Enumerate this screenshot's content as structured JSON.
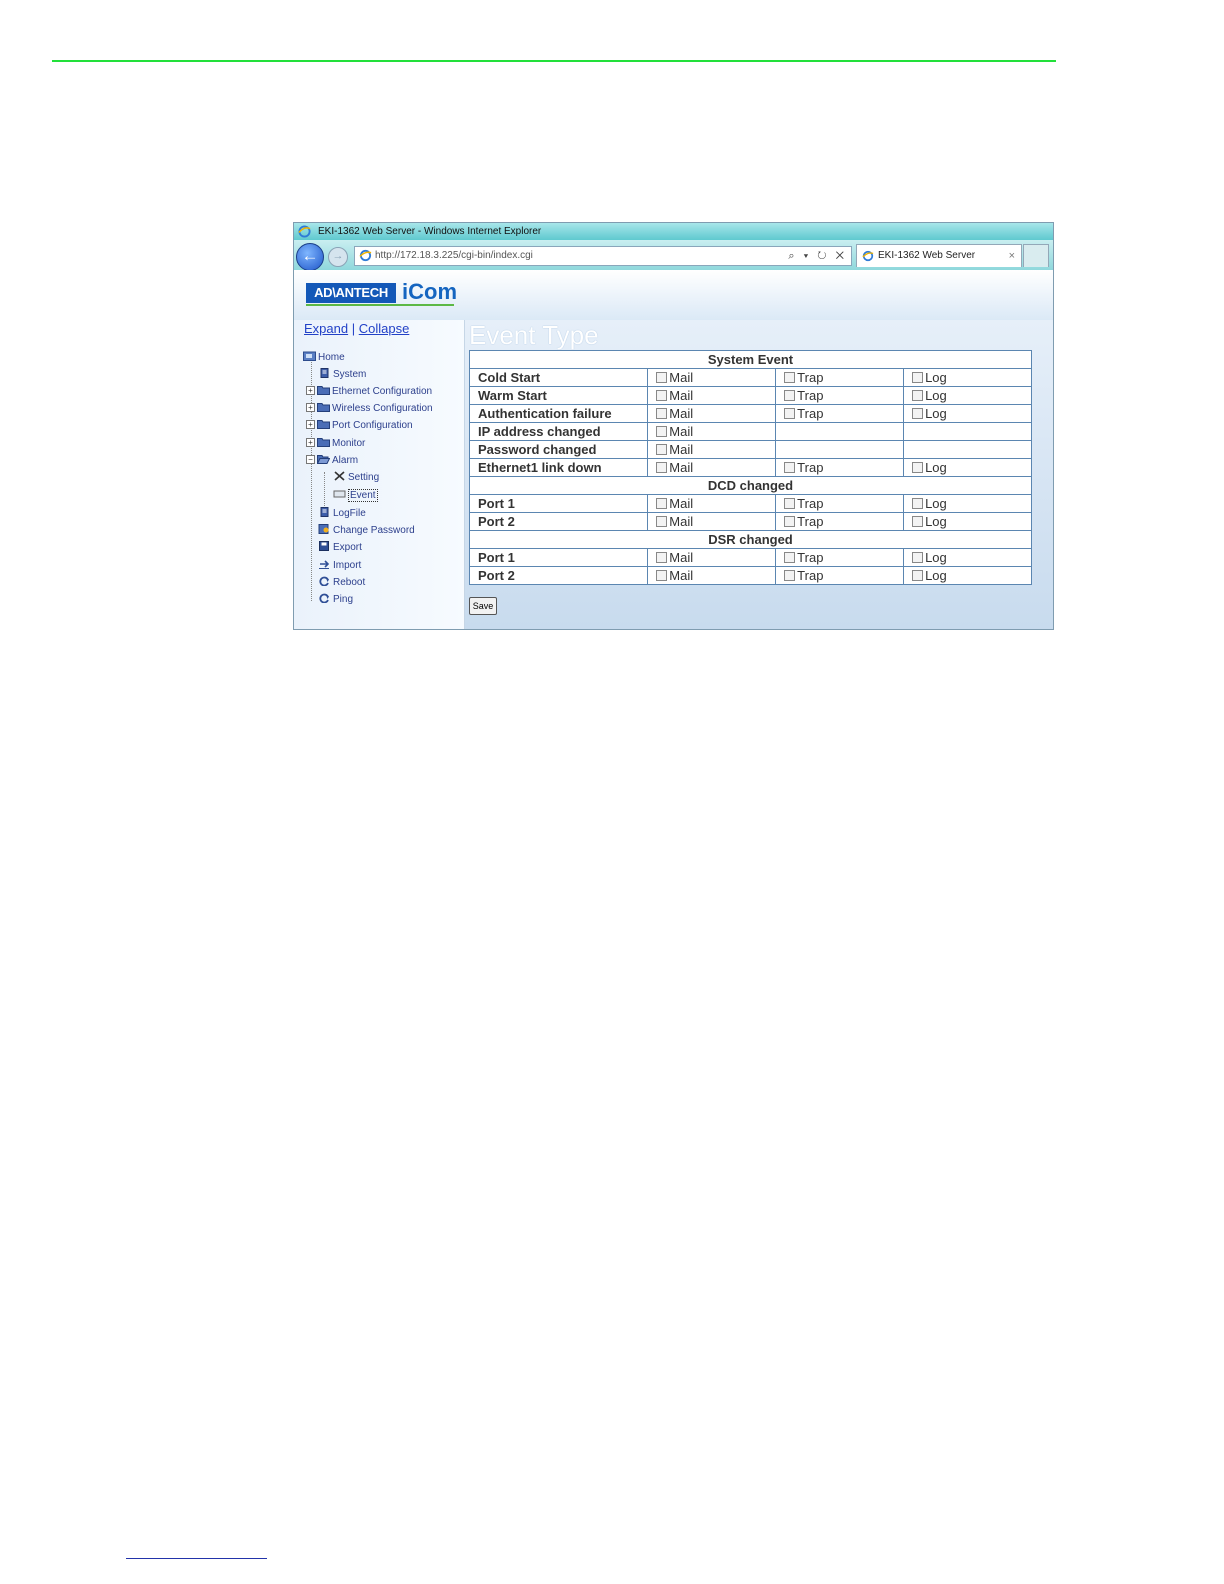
{
  "browser": {
    "window_title": "EKI-1362 Web Server - Windows Internet Explorer",
    "address": "http://172.18.3.225/cgi-bin/index.cgi",
    "address_tools": "⌕ ▾ ↻ ✕",
    "tab_label": "EKI-1362 Web Server",
    "tab_close": "×",
    "back": "←",
    "forward": "→"
  },
  "header": {
    "logo_brand": "AD\\ANTECH",
    "logo_product": "iCom"
  },
  "sidebar": {
    "expand": "Expand",
    "separator": "|",
    "collapse": "Collapse",
    "tree": [
      {
        "label": "Home"
      },
      {
        "label": "System"
      },
      {
        "label": "Ethernet Configuration"
      },
      {
        "label": "Wireless Configuration"
      },
      {
        "label": "Port Configuration"
      },
      {
        "label": "Monitor"
      },
      {
        "label": "Alarm"
      },
      {
        "label": "Setting"
      },
      {
        "label": "Event"
      },
      {
        "label": "LogFile"
      },
      {
        "label": "Change Password"
      },
      {
        "label": "Export"
      },
      {
        "label": "Import"
      },
      {
        "label": "Reboot"
      },
      {
        "label": "Ping"
      }
    ]
  },
  "main": {
    "title": "Event Type",
    "option_labels": {
      "mail": "Mail",
      "trap": "Trap",
      "log": "Log"
    },
    "sections": [
      {
        "title": "System Event",
        "rows": [
          {
            "name": "Cold Start"
          },
          {
            "name": "Warm Start"
          },
          {
            "name": "Authentication failure"
          },
          {
            "name": "IP address changed"
          },
          {
            "name": "Password changed"
          },
          {
            "name": "Ethernet1 link down"
          }
        ]
      },
      {
        "title": "DCD changed",
        "rows": [
          {
            "name": "Port 1"
          },
          {
            "name": "Port 2"
          }
        ]
      },
      {
        "title": "DSR changed",
        "rows": [
          {
            "name": "Port 1"
          },
          {
            "name": "Port 2"
          }
        ]
      }
    ],
    "save_label": "Save"
  }
}
